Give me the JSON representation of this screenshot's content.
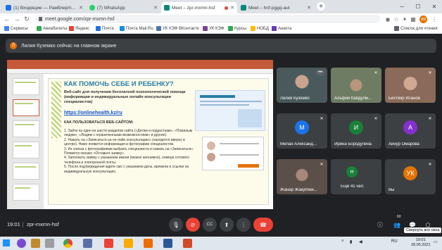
{
  "browser": {
    "tabs": [
      {
        "title": "(1) Входящие — Рамблер/почта",
        "color": "#1a73e8",
        "active": false
      },
      {
        "title": "(7) WhatsApp",
        "color": "#25d366",
        "active": false
      },
      {
        "title": "Meet – zpr-mxmn-hsf",
        "color": "#00897b",
        "active": true
      },
      {
        "title": "Meet – hnf-pggq-aut",
        "color": "#00897b",
        "active": false
      }
    ],
    "new_tab": "+",
    "url": "meet.google.com/zpr-mxmn-hsf",
    "profile_initials": "ЖК",
    "bookmarks": [
      {
        "label": "Сервисы",
        "color": "#4285f4"
      },
      {
        "label": "Авиабилеты",
        "color": "#34a853"
      },
      {
        "label": "Яндекс",
        "color": "#ea4335"
      },
      {
        "label": "Почта",
        "color": "#1a73e8"
      },
      {
        "label": "Почта Mail.Ru",
        "color": "#168de2"
      },
      {
        "label": "УК КЭФ ВКонтакте",
        "color": "#4a76a8"
      },
      {
        "label": "УК КЭФ",
        "color": "#7b4397"
      },
      {
        "label": "Курсы",
        "color": "#34a853"
      },
      {
        "label": "НОБД",
        "color": "#fbbc04"
      },
      {
        "label": "Анкета",
        "color": "#673ab7"
      }
    ],
    "reading_list": "Список для чтения"
  },
  "meet": {
    "banner": {
      "initial": "Л",
      "text": "Лилия Куземко сейчас на главном экране"
    },
    "slide": {
      "title": "КАК ПОМОЧЬ  СЕБЕ И РЕБЕНКУ?",
      "subtitle": "Веб-сайт для получения бесплатной психологической помощи (информация и индивидуальные  онлайн консультации специалистов)",
      "link": "https://onlinehealth.kz/ru",
      "how": "КАК ПОЛЬЗОВАТЬСЯ ВЕБ-САЙТОМ:",
      "body": "1. Зайти на один из шести разделов сайта («Детям и подросткам», «Пожилым людям», «Людям с ограниченными возможностями» и другие).\n2. Нажать на «Записаться на он-лайн консультацию» (находится вверху в центре). Ниже появится информация и фотографии специалистов.\n3. Из списка с фотографиями выбрать специалиста и нажать на «Записаться». Появится окошко «Оставьте заявку».\n4. Заполнить заявку с указанием имени (можно анонимно), номера сотового телефона и электронной почты.\n5. После подтверждения ждите смс с указанием даты, времени и ссылки на индивидуальную консультацию."
    },
    "participants": [
      {
        "name": "Лилия Куземко",
        "type": "video",
        "color": "#7a8a8c"
      },
      {
        "name": "Альфия Кабдулм...",
        "type": "video",
        "color": "#6e7c63"
      },
      {
        "name": "Бехтияр Исанов",
        "type": "video",
        "color": "#8a6a5a"
      },
      {
        "name": "Милан Александ...",
        "type": "avatar",
        "initial": "М",
        "color": "#1a73e8"
      },
      {
        "name": "Ирина Бородулина",
        "type": "avatar",
        "initial": "И",
        "color": "#188038"
      },
      {
        "name": "Айнур Омарова",
        "type": "avatar",
        "initial": "А",
        "color": "#8430ce"
      },
      {
        "name": "Жанар Жакупбек...",
        "type": "video",
        "color": "#5b4f4a"
      },
      {
        "name": "Ещё 41 чел.",
        "type": "more",
        "initial": "Н",
        "color": "#188038"
      },
      {
        "name": "Вы",
        "type": "avatar",
        "initial": "УК",
        "color": "#e37400"
      }
    ],
    "bottom": {
      "time": "19:01",
      "code": "zpr-mxmn-hsf",
      "people_count": "60",
      "tooltip": "Свернуть все окна"
    }
  },
  "taskbar": {
    "lang": "RU",
    "time": "19:01",
    "date": "28.05.2021"
  }
}
